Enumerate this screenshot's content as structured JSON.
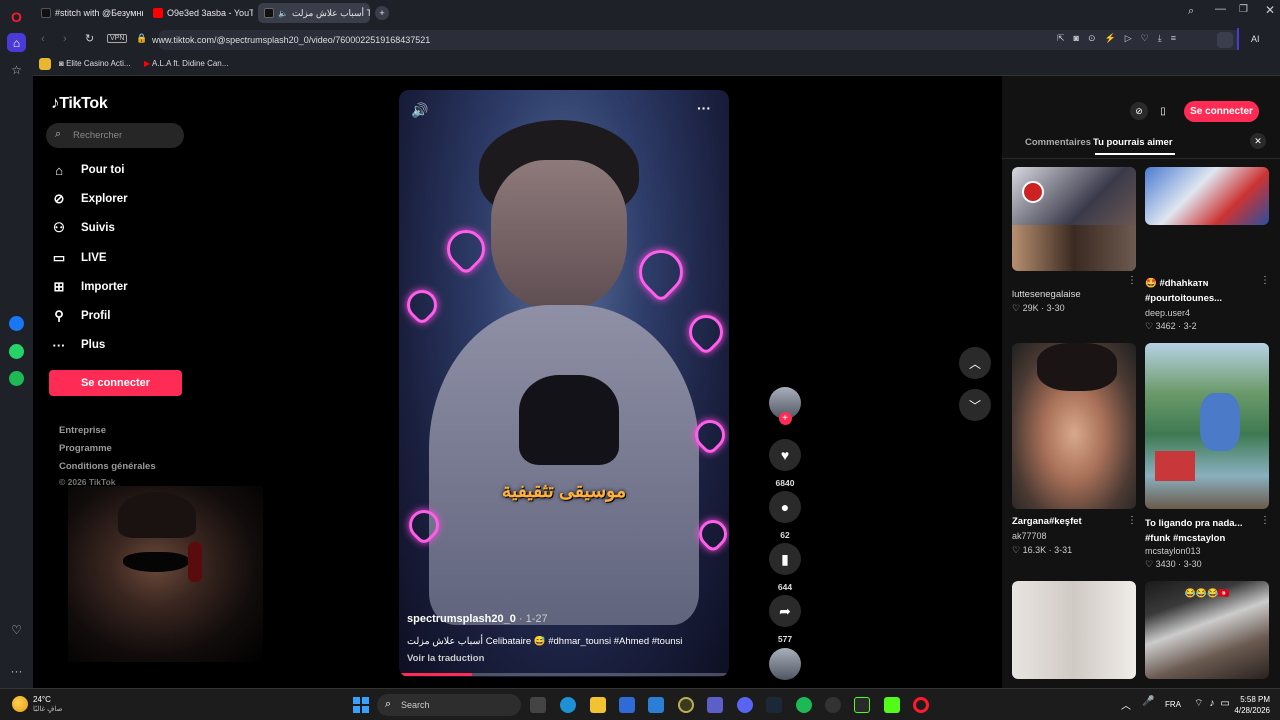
{
  "browser": {
    "tabs": [
      {
        "title": "#stitch with @Безумный",
        "icon_color": "#111111"
      },
      {
        "title": "O9e3ed 3asba - YouTube",
        "icon_color": "#ff0000"
      },
      {
        "title": "أسباب علاش مزلت Tok",
        "icon_color": "#111111"
      }
    ],
    "add_tab": "+",
    "vpn_label": "VPN",
    "url": "www.tiktok.com/@spectrumsplash20_0/video/7600022519168437521",
    "ai_label": "AI",
    "bookmarks": [
      {
        "label": "Elite Casino Acti..."
      },
      {
        "label": "A.L.A ft. Didine Can..."
      }
    ]
  },
  "sidebar": {
    "logo": "TikTok",
    "search_placeholder": "Rechercher",
    "nav": [
      {
        "label": "Pour toi",
        "icon": "home-icon",
        "glyph": "⌂"
      },
      {
        "label": "Explorer",
        "icon": "compass-icon",
        "glyph": "⊘"
      },
      {
        "label": "Suivis",
        "icon": "following-icon",
        "glyph": "⚇"
      },
      {
        "label": "LIVE",
        "icon": "live-icon",
        "glyph": "▭"
      },
      {
        "label": "Importer",
        "icon": "upload-icon",
        "glyph": "⊞"
      },
      {
        "label": "Profil",
        "icon": "profile-icon",
        "glyph": "⚲"
      },
      {
        "label": "Plus",
        "icon": "more-icon",
        "glyph": "···"
      }
    ],
    "login_button": "Se connecter",
    "footer": [
      "Entreprise",
      "Programme",
      "Conditions générales",
      "© 2026 TikTok"
    ]
  },
  "video": {
    "overlay_text": "موسيقى تثقيفية",
    "author": "spectrumsplash20_0",
    "date": "· 1-27",
    "description": "أسباب علاش مزلت Celibataire 😅 #dhmar_tounsi #Ahmed #tounsi",
    "translate": "Voir la traduction",
    "progress": 0.22
  },
  "actions": {
    "likes": "6840",
    "comments": "62",
    "saves": "644",
    "shares": "577"
  },
  "header_right": {
    "login_button": "Se connecter"
  },
  "panel": {
    "tabs": [
      "Commentaires",
      "Tu pourrais aimer"
    ],
    "active_tab": 1,
    "cards": [
      {
        "caption": "luttesenegalaise",
        "author": "",
        "likes": "29K",
        "date": "3-30"
      },
      {
        "caption": "🤩 #dhahkaᴛɴ #pourtoitounes...",
        "author": "deep.user4",
        "likes": "3462",
        "date": "3-2"
      },
      {
        "caption": "Zargana#keşfet",
        "author": "ak77708",
        "likes": "16.3K",
        "date": "3-31"
      },
      {
        "caption": "To ligando pra nada... #funk #mcstaylon",
        "author": "mcstaylon013",
        "likes": "3430",
        "date": "3-30"
      }
    ],
    "card6_label": "😂😂😂🇹🇳"
  },
  "taskbar": {
    "weather_temp": "24°C",
    "weather_desc": "صافٍ غالبًا",
    "search_label": "Search",
    "lang": "FRA",
    "time": "5:58 PM",
    "date": "4/28/2026"
  },
  "colors": {
    "accent": "#fe2c55",
    "bg": "#000000",
    "panel": "#121212"
  }
}
